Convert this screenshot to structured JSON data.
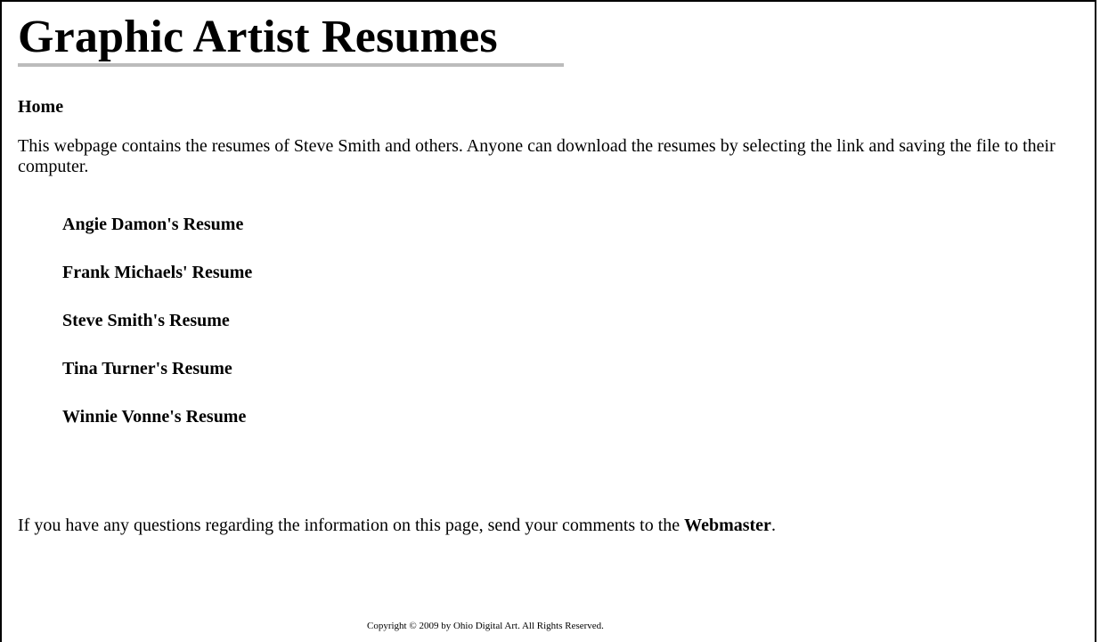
{
  "header": {
    "title": "Graphic Artist Resumes"
  },
  "nav": {
    "home_label": "Home"
  },
  "intro": {
    "text": "This webpage contains the resumes of Steve Smith and others. Anyone can download the resumes by selecting the link and saving the file to their computer."
  },
  "resumes": [
    {
      "label": "Angie Damon's Resume"
    },
    {
      "label": "Frank Michaels' Resume"
    },
    {
      "label": "Steve Smith's Resume"
    },
    {
      "label": "Tina Turner's Resume"
    },
    {
      "label": "Winnie Vonne's Resume"
    }
  ],
  "footer": {
    "questions_text": "If you have any questions regarding the information on this page, send your comments to the ",
    "webmaster_label": "Webmaster",
    "questions_end": ".",
    "copyright": "Copyright © 2009 by Ohio Digital Art. All Rights Reserved."
  }
}
